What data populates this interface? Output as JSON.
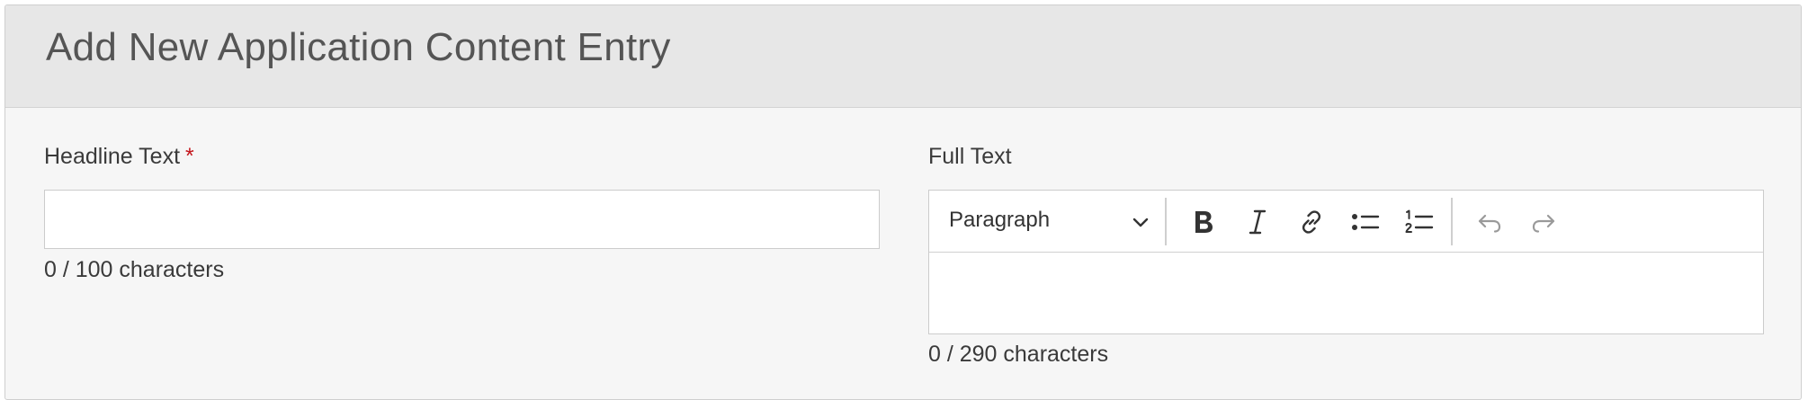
{
  "header": {
    "title": "Add New Application Content Entry"
  },
  "headline": {
    "label": "Headline Text",
    "required_marker": "*",
    "value": "",
    "counter": "0 / 100 characters"
  },
  "full_text": {
    "label": "Full Text",
    "format_select": {
      "selected": "Paragraph"
    },
    "toolbar_icons": [
      "bold-icon",
      "italic-icon",
      "link-icon",
      "bulleted-list-icon",
      "numbered-list-icon",
      "undo-icon",
      "redo-icon"
    ],
    "counter": "0 / 290 characters"
  },
  "colors": {
    "header_bg": "#e7e7e7",
    "panel_bg": "#f6f6f6",
    "required": "#c4161c",
    "text": "#3a3a3a",
    "disabled_icon": "#9a9a9a"
  }
}
